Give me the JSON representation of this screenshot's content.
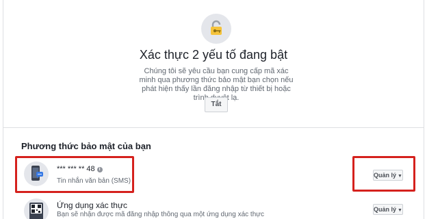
{
  "header": {
    "icon": "lock-key-icon",
    "title": "Xác thực 2 yếu tố đang bật",
    "description": "Chúng tôi sẽ yêu cầu bạn cung cấp mã xác minh qua phương thức bảo mật bạn chọn nếu phát hiện thấy lần đăng nhập từ thiết bị hoặc trình duyệt lạ.",
    "off_button": "Tắt"
  },
  "security_methods": {
    "heading": "Phương thức bảo mật của bạn",
    "items": [
      {
        "icon": "phone-sms-icon",
        "name": "*** *** ** 48",
        "info_icon": "info-icon",
        "info_glyph": "i",
        "subtitle": "Tin nhắn văn bản (SMS)",
        "manage_label": "Quản lý",
        "caret_glyph": "▼"
      },
      {
        "icon": "qr-code-icon",
        "name": "Ứng dụng xác thực",
        "subtitle": "Bạn sẽ nhận được mã đăng nhập thông qua một ứng dụng xác thực",
        "manage_label": "Quản lý",
        "caret_glyph": "▼"
      }
    ]
  },
  "colors": {
    "highlight": "#d5211d",
    "lock_yellow": "#f5c33b"
  }
}
